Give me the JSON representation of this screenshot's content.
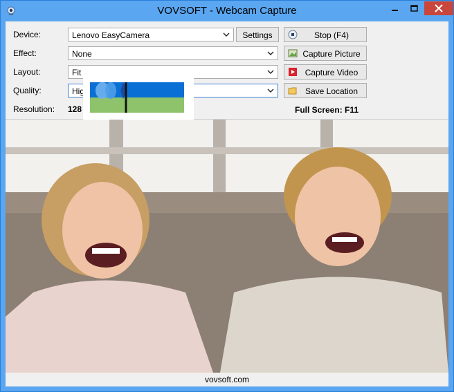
{
  "window": {
    "title": "VOVSOFT - Webcam Capture",
    "icons": {
      "app": "webcam-icon",
      "minimize": "minimize-icon",
      "maximize": "maximize-icon",
      "close": "close-icon"
    }
  },
  "form": {
    "device": {
      "label": "Device:",
      "value": "Lenovo EasyCamera"
    },
    "effect": {
      "label": "Effect:",
      "value": "None"
    },
    "layout": {
      "label": "Layout:",
      "value": "Fit"
    },
    "quality": {
      "label": "Quality:",
      "value": "Hig"
    },
    "settings_label": "Settings",
    "resolution": {
      "label": "Resolution:",
      "value": "128"
    }
  },
  "actions": {
    "stop": {
      "label": "Stop (F4)",
      "icon": "stop-icon"
    },
    "capture_picture": {
      "label": "Capture Picture",
      "icon": "picture-icon"
    },
    "capture_video": {
      "label": "Capture Video",
      "icon": "video-icon"
    },
    "save_location": {
      "label": "Save Location",
      "icon": "folder-icon"
    }
  },
  "full_screen_hint": "Full Screen: F11",
  "footer": {
    "text": "vovsoft.com"
  },
  "colors": {
    "titlebar": "#5aa6f0",
    "close": "#c9463d",
    "panel": "#f0f0f0"
  }
}
